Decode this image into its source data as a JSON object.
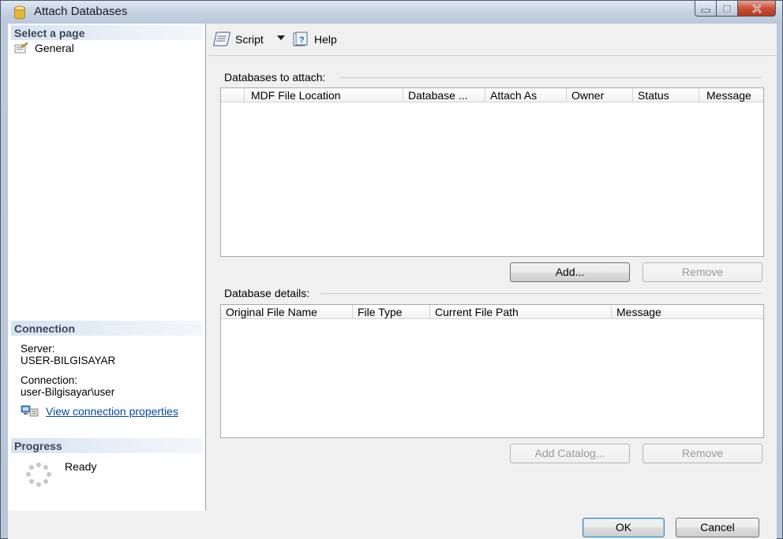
{
  "window": {
    "title": "Attach Databases"
  },
  "left": {
    "select_page_header": "Select a page",
    "pages": [
      {
        "label": "General"
      }
    ],
    "connection_header": "Connection",
    "server_label": "Server:",
    "server_value": "USER-BILGISAYAR",
    "connection_label": "Connection:",
    "connection_value": "user-Bilgisayar\\user",
    "view_connection_link": "View connection properties",
    "progress_header": "Progress",
    "progress_status": "Ready"
  },
  "toolbar": {
    "script_label": "Script",
    "help_label": "Help"
  },
  "attach": {
    "group_label": "Databases to attach:",
    "columns": [
      "MDF File Location",
      "Database ...",
      "Attach As",
      "Owner",
      "Status",
      "Message"
    ],
    "add_label": "Add...",
    "remove_label": "Remove"
  },
  "details": {
    "group_label": "Database details:",
    "columns": [
      "Original File Name",
      "File Type",
      "Current File Path",
      "Message"
    ],
    "add_catalog_label": "Add Catalog...",
    "remove_label": "Remove"
  },
  "footer": {
    "ok_label": "OK",
    "cancel_label": "Cancel"
  }
}
